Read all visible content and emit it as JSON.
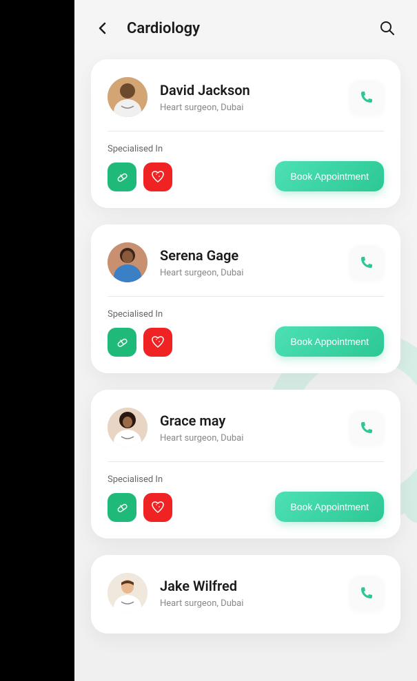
{
  "header": {
    "title": "Cardiology"
  },
  "specialisedLabel": "Specialised In",
  "bookLabel": "Book Appointment",
  "doctors": [
    {
      "name": "David Jackson",
      "subtitle": "Heart surgeon, Dubai"
    },
    {
      "name": "Serena Gage",
      "subtitle": "Heart surgeon, Dubai"
    },
    {
      "name": "Grace may",
      "subtitle": "Heart surgeon, Dubai"
    },
    {
      "name": "Jake Wilfred",
      "subtitle": "Heart surgeon, Dubai"
    }
  ],
  "colors": {
    "accent": "#2cc894",
    "specGreen": "#1fba7a",
    "specRed": "#ef2323"
  }
}
